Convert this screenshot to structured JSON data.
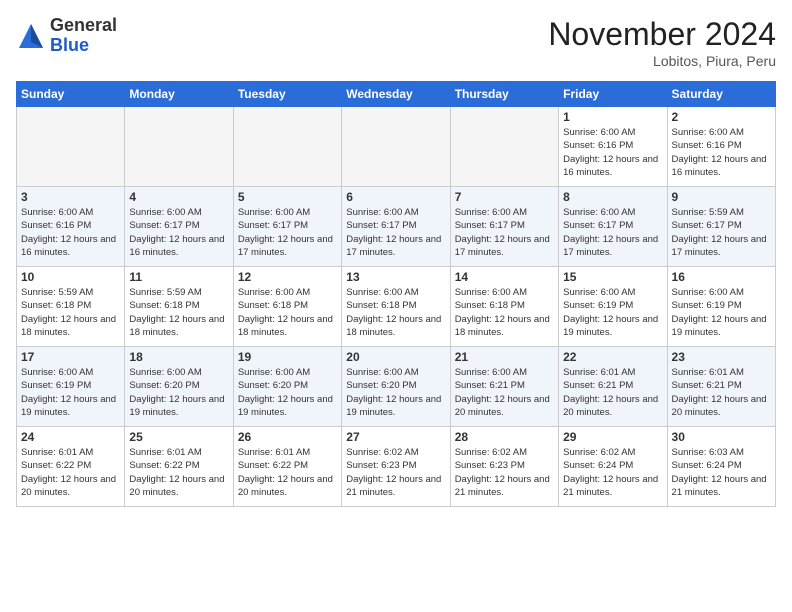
{
  "header": {
    "logo_general": "General",
    "logo_blue": "Blue",
    "month_title": "November 2024",
    "location": "Lobitos, Piura, Peru"
  },
  "days_of_week": [
    "Sunday",
    "Monday",
    "Tuesday",
    "Wednesday",
    "Thursday",
    "Friday",
    "Saturday"
  ],
  "weeks": [
    [
      {
        "day": "",
        "info": ""
      },
      {
        "day": "",
        "info": ""
      },
      {
        "day": "",
        "info": ""
      },
      {
        "day": "",
        "info": ""
      },
      {
        "day": "",
        "info": ""
      },
      {
        "day": "1",
        "info": "Sunrise: 6:00 AM\nSunset: 6:16 PM\nDaylight: 12 hours and 16 minutes."
      },
      {
        "day": "2",
        "info": "Sunrise: 6:00 AM\nSunset: 6:16 PM\nDaylight: 12 hours and 16 minutes."
      }
    ],
    [
      {
        "day": "3",
        "info": "Sunrise: 6:00 AM\nSunset: 6:16 PM\nDaylight: 12 hours and 16 minutes."
      },
      {
        "day": "4",
        "info": "Sunrise: 6:00 AM\nSunset: 6:17 PM\nDaylight: 12 hours and 16 minutes."
      },
      {
        "day": "5",
        "info": "Sunrise: 6:00 AM\nSunset: 6:17 PM\nDaylight: 12 hours and 17 minutes."
      },
      {
        "day": "6",
        "info": "Sunrise: 6:00 AM\nSunset: 6:17 PM\nDaylight: 12 hours and 17 minutes."
      },
      {
        "day": "7",
        "info": "Sunrise: 6:00 AM\nSunset: 6:17 PM\nDaylight: 12 hours and 17 minutes."
      },
      {
        "day": "8",
        "info": "Sunrise: 6:00 AM\nSunset: 6:17 PM\nDaylight: 12 hours and 17 minutes."
      },
      {
        "day": "9",
        "info": "Sunrise: 5:59 AM\nSunset: 6:17 PM\nDaylight: 12 hours and 17 minutes."
      }
    ],
    [
      {
        "day": "10",
        "info": "Sunrise: 5:59 AM\nSunset: 6:18 PM\nDaylight: 12 hours and 18 minutes."
      },
      {
        "day": "11",
        "info": "Sunrise: 5:59 AM\nSunset: 6:18 PM\nDaylight: 12 hours and 18 minutes."
      },
      {
        "day": "12",
        "info": "Sunrise: 6:00 AM\nSunset: 6:18 PM\nDaylight: 12 hours and 18 minutes."
      },
      {
        "day": "13",
        "info": "Sunrise: 6:00 AM\nSunset: 6:18 PM\nDaylight: 12 hours and 18 minutes."
      },
      {
        "day": "14",
        "info": "Sunrise: 6:00 AM\nSunset: 6:18 PM\nDaylight: 12 hours and 18 minutes."
      },
      {
        "day": "15",
        "info": "Sunrise: 6:00 AM\nSunset: 6:19 PM\nDaylight: 12 hours and 19 minutes."
      },
      {
        "day": "16",
        "info": "Sunrise: 6:00 AM\nSunset: 6:19 PM\nDaylight: 12 hours and 19 minutes."
      }
    ],
    [
      {
        "day": "17",
        "info": "Sunrise: 6:00 AM\nSunset: 6:19 PM\nDaylight: 12 hours and 19 minutes."
      },
      {
        "day": "18",
        "info": "Sunrise: 6:00 AM\nSunset: 6:20 PM\nDaylight: 12 hours and 19 minutes."
      },
      {
        "day": "19",
        "info": "Sunrise: 6:00 AM\nSunset: 6:20 PM\nDaylight: 12 hours and 19 minutes."
      },
      {
        "day": "20",
        "info": "Sunrise: 6:00 AM\nSunset: 6:20 PM\nDaylight: 12 hours and 19 minutes."
      },
      {
        "day": "21",
        "info": "Sunrise: 6:00 AM\nSunset: 6:21 PM\nDaylight: 12 hours and 20 minutes."
      },
      {
        "day": "22",
        "info": "Sunrise: 6:01 AM\nSunset: 6:21 PM\nDaylight: 12 hours and 20 minutes."
      },
      {
        "day": "23",
        "info": "Sunrise: 6:01 AM\nSunset: 6:21 PM\nDaylight: 12 hours and 20 minutes."
      }
    ],
    [
      {
        "day": "24",
        "info": "Sunrise: 6:01 AM\nSunset: 6:22 PM\nDaylight: 12 hours and 20 minutes."
      },
      {
        "day": "25",
        "info": "Sunrise: 6:01 AM\nSunset: 6:22 PM\nDaylight: 12 hours and 20 minutes."
      },
      {
        "day": "26",
        "info": "Sunrise: 6:01 AM\nSunset: 6:22 PM\nDaylight: 12 hours and 20 minutes."
      },
      {
        "day": "27",
        "info": "Sunrise: 6:02 AM\nSunset: 6:23 PM\nDaylight: 12 hours and 21 minutes."
      },
      {
        "day": "28",
        "info": "Sunrise: 6:02 AM\nSunset: 6:23 PM\nDaylight: 12 hours and 21 minutes."
      },
      {
        "day": "29",
        "info": "Sunrise: 6:02 AM\nSunset: 6:24 PM\nDaylight: 12 hours and 21 minutes."
      },
      {
        "day": "30",
        "info": "Sunrise: 6:03 AM\nSunset: 6:24 PM\nDaylight: 12 hours and 21 minutes."
      }
    ]
  ]
}
